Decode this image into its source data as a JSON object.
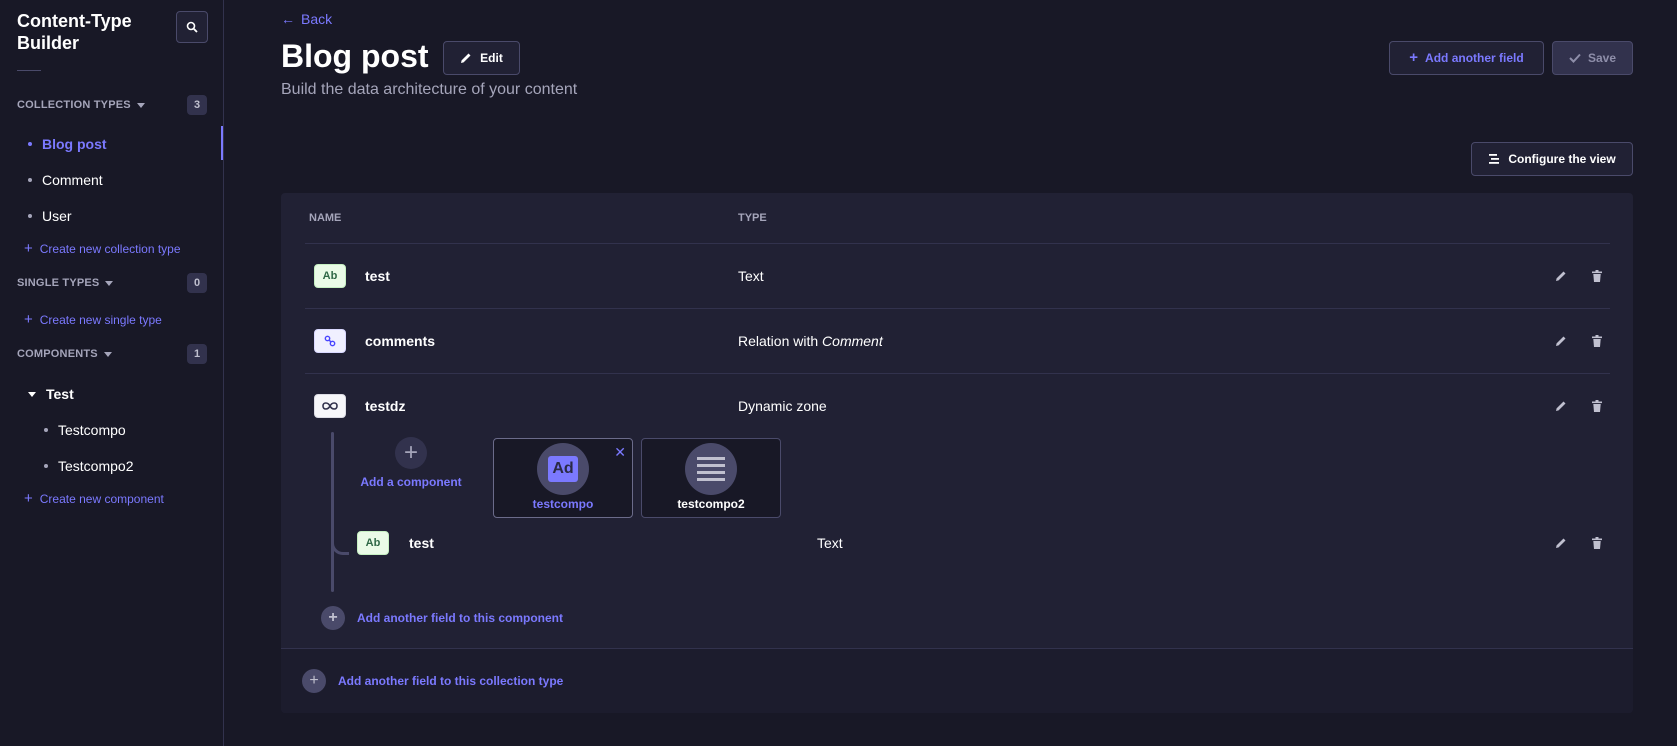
{
  "sidebar": {
    "title": "Content-Type Builder",
    "sections": {
      "collection": {
        "label": "COLLECTION TYPES",
        "count": "3",
        "create": "Create new collection type",
        "items": [
          {
            "label": "Blog post"
          },
          {
            "label": "Comment"
          },
          {
            "label": "User"
          }
        ]
      },
      "single": {
        "label": "SINGLE TYPES",
        "count": "0",
        "create": "Create new single type"
      },
      "components": {
        "label": "COMPONENTS",
        "count": "1",
        "create": "Create new component",
        "category": "Test",
        "items": [
          {
            "label": "Testcompo"
          },
          {
            "label": "Testcompo2"
          }
        ]
      }
    }
  },
  "header": {
    "back": "Back",
    "title": "Blog post",
    "edit": "Edit",
    "subtitle": "Build the data architecture of your content",
    "add_field": "Add another field",
    "save": "Save",
    "configure": "Configure the view"
  },
  "table": {
    "columns": {
      "name": "NAME",
      "type": "TYPE"
    },
    "rows": [
      {
        "icon": "Ab",
        "name": "test",
        "type": "Text"
      },
      {
        "name": "comments",
        "type_prefix": "Relation with",
        "type_target": "Comment"
      },
      {
        "name": "testdz",
        "type": "Dynamic zone"
      }
    ],
    "dynamic_zone": {
      "add_component": "Add a component",
      "components": [
        {
          "label": "testcompo",
          "icon": "Ad"
        },
        {
          "label": "testcompo2"
        }
      ],
      "sub_field": {
        "icon": "Ab",
        "name": "test",
        "type": "Text"
      },
      "add_to_component": "Add another field to this component"
    },
    "add_to_collection": "Add another field to this collection type"
  },
  "colors": {
    "accent": "#7b79ff",
    "background": "#181826",
    "card": "#212134"
  }
}
